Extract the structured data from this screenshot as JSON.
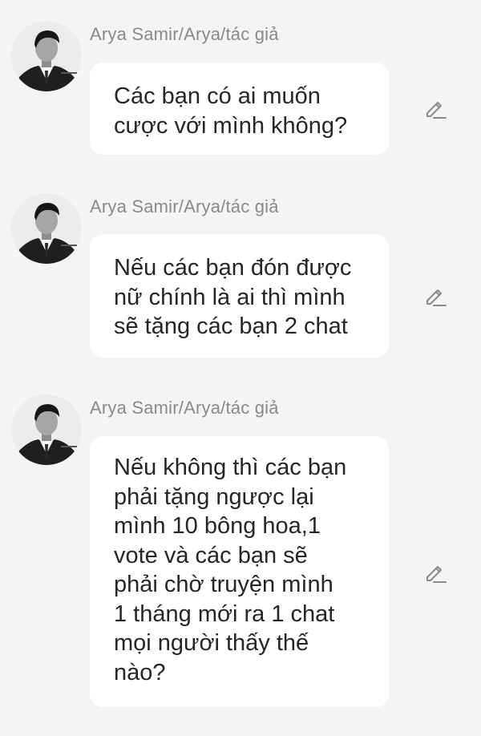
{
  "messages": [
    {
      "sender": "Arya Samir/Arya/tác giả",
      "text": "Các bạn có ai muốn\ncược với mình không?",
      "avatar_icon": "author-avatar",
      "edit_icon": "pencil-icon"
    },
    {
      "sender": "Arya Samir/Arya/tác giả",
      "text": "Nếu các bạn đón được\nnữ chính là ai thì mình\nsẽ tặng các bạn 2 chat",
      "avatar_icon": "author-avatar",
      "edit_icon": "pencil-icon"
    },
    {
      "sender": "Arya Samir/Arya/tác giả",
      "text": "Nếu không thì các bạn\nphải tặng ngược lại\nmình 10 bông hoa,1\nvote và các bạn sẽ\nphải chờ truyện mình\n1 tháng mới ra 1 chat\nmọi người thấy thế\nnào?",
      "avatar_icon": "author-avatar",
      "edit_icon": "pencil-icon"
    }
  ]
}
